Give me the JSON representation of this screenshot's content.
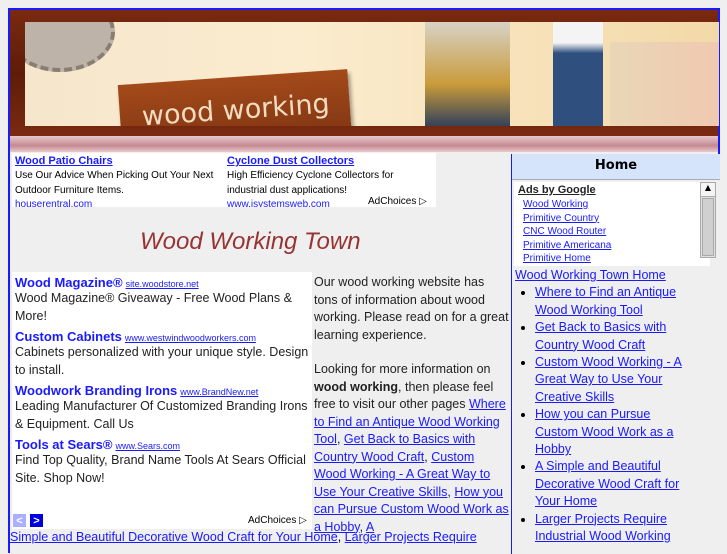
{
  "header": {
    "logo_text": "wood working"
  },
  "top_ads": [
    {
      "title": "Wood Patio Chairs",
      "desc": "Use Our Advice When Picking Out Your Next Outdoor Furniture Items.",
      "url": "houserentral.com"
    },
    {
      "title": "Cyclone Dust Collectors",
      "desc": "High Efficiency Cyclone Collectors for industrial dust applications!",
      "url": "www.isystemsweb.com"
    }
  ],
  "adchoices": "AdChoices ▷",
  "site_title": "Wood Working Town",
  "left_ads": [
    {
      "title": "Wood Magazine®",
      "url": "site.woodstore.net",
      "desc": "Wood Magazine® Giveaway - Free Wood Plans & More!"
    },
    {
      "title": "Custom Cabinets",
      "url": "www.westwindwoodworkers.com",
      "desc": "Cabinets personalized with your unique style. Design to install."
    },
    {
      "title": "Woodwork Branding Irons",
      "url": "www.BrandNew.net",
      "desc": "Leading Manufacturer Of Customized Branding Irons & Equipment. Call Us"
    },
    {
      "title": "Tools at Sears®",
      "url": "www.Sears.com",
      "desc": "Find Top Quality, Brand Name Tools At Sears Official Site. Shop Now!"
    }
  ],
  "nav": {
    "prev": "<",
    "next": ">"
  },
  "main": {
    "intro": "Our wood working website has tons of information about wood working. Please read on for a great learning experience.",
    "p2_a": "Looking for more information on ",
    "p2_bold": "wood working",
    "p2_b": ", then please feel free to visit our other pages ",
    "links": [
      "Where to Find an Antique Wood Working Tool",
      "Get Back to Basics with Country Wood Craft",
      "Custom Wood Working - A Great Way to Use Your Creative Skills",
      "How you can Pursue Custom Wood Work as a Hobby",
      "A"
    ],
    "sep": ", "
  },
  "bottom": {
    "link1": "Simple and Beautiful Decorative Wood Craft for Your Home",
    "sep": ", ",
    "link2": "Larger Projects Require"
  },
  "sidebar": {
    "home": "Home",
    "ads_header": "Ads by Google",
    "ads": [
      "Wood Working",
      "Primitive Country",
      "CNC Wood Router",
      "Primitive Americana",
      "Primitive Home"
    ],
    "home_link": "Wood Working Town Home",
    "links": [
      "Where to Find an Antique Wood Working Tool",
      "Get Back to Basics with Country Wood Craft",
      "Custom Wood Working - A Great Way to Use Your Creative Skills",
      "How you can Pursue Custom Wood Work as a Hobby",
      "A Simple and Beautiful Decorative Wood Craft for Your Home",
      "Larger Projects Require Industrial Wood Working"
    ]
  }
}
